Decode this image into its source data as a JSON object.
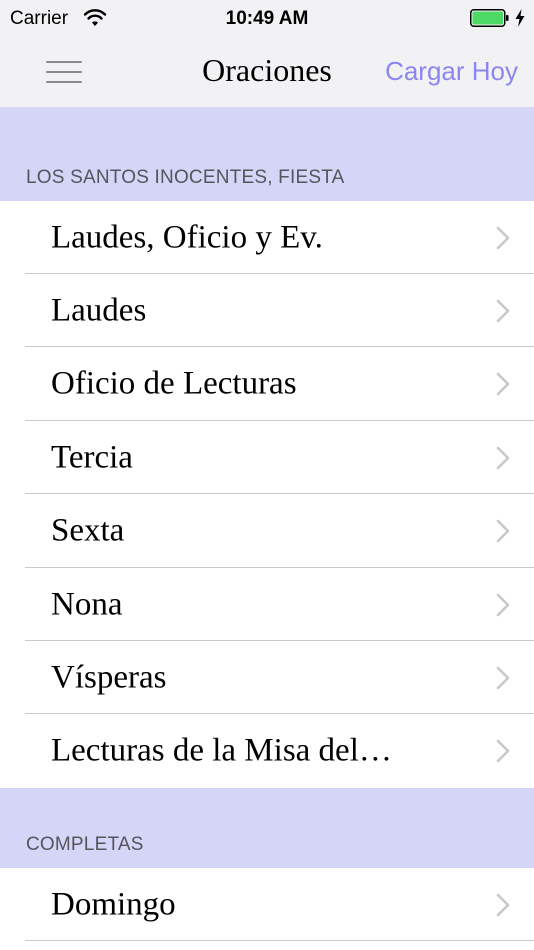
{
  "status_bar": {
    "carrier": "Carrier",
    "time": "10:49 AM",
    "battery_color": "#4cd964"
  },
  "nav_bar": {
    "title": "Oraciones",
    "action_label": "Cargar Hoy",
    "action_color": "#8c86f0"
  },
  "sections": [
    {
      "title": "LOS SANTOS INOCENTES, FIESTA",
      "items": [
        {
          "label": "Laudes, Oficio y Ev."
        },
        {
          "label": "Laudes"
        },
        {
          "label": "Oficio de Lecturas"
        },
        {
          "label": "Tercia"
        },
        {
          "label": "Sexta"
        },
        {
          "label": "Nona"
        },
        {
          "label": "Vísperas"
        },
        {
          "label": "Lecturas de la Misa del…"
        }
      ]
    },
    {
      "title": "COMPLETAS",
      "items": [
        {
          "label": "Domingo"
        }
      ]
    }
  ],
  "colors": {
    "section_background": "#d5d5f7",
    "chevron": "#c7c7cc",
    "separator": "#c8c7cc"
  }
}
